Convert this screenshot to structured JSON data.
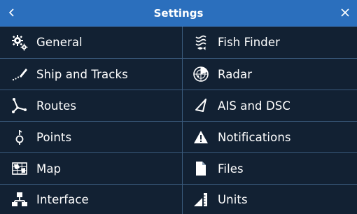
{
  "header": {
    "title": "Settings",
    "back_icon": "chevron-left-icon",
    "close_icon": "close-icon",
    "background": "#2b6fbd"
  },
  "menu": {
    "items": [
      {
        "label": "General",
        "icon": "gears-icon"
      },
      {
        "label": "Fish Finder",
        "icon": "fish-finder-icon"
      },
      {
        "label": "Ship and Tracks",
        "icon": "ship-track-icon"
      },
      {
        "label": "Radar",
        "icon": "radar-icon"
      },
      {
        "label": "Routes",
        "icon": "routes-icon"
      },
      {
        "label": "AIS and DSC",
        "icon": "ais-triangle-icon"
      },
      {
        "label": "Points",
        "icon": "point-marker-icon"
      },
      {
        "label": "Notifications",
        "icon": "warning-icon"
      },
      {
        "label": "Map",
        "icon": "map-icon"
      },
      {
        "label": "Files",
        "icon": "file-icon"
      },
      {
        "label": "Interface",
        "icon": "interface-icon"
      },
      {
        "label": "Units",
        "icon": "units-icon"
      }
    ]
  },
  "colors": {
    "background": "#122133",
    "divider": "#3a5a7c",
    "text": "#ffffff"
  }
}
